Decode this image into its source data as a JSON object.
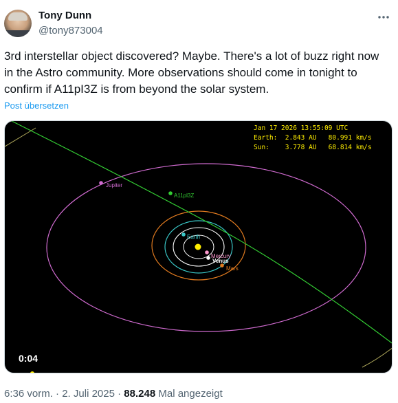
{
  "author": {
    "name": "Tony Dunn",
    "handle": "@tony873004"
  },
  "tweet": {
    "text": "3rd interstellar object discovered? Maybe. There's a lot of buzz right now in the Astro community. More observations should come in tonight to confirm if A11pI3Z is from beyond the solar system.",
    "translate_label": "Post übersetzen"
  },
  "media": {
    "info_line1": "Jan 17 2026 13:55:09 UTC",
    "info_line2": "Earth:  2.843 AU   80.991 km/s",
    "info_line3": "Sun:    3.778 AU   68.814 km/s",
    "video_time": "0:04",
    "labels": {
      "jupiter": "Jupiter",
      "object": "A11pl3Z",
      "earth": "Earth",
      "mercury": "Mercury",
      "venus": "Venus",
      "mars": "Mars"
    },
    "colors": {
      "jupiter": "#d06bd0",
      "object": "#33cc33",
      "earth": "#39c6c6",
      "mars": "#e07a1f",
      "venus": "#ffffff",
      "mercury": "#ff9ad0",
      "sun": "#ffee00",
      "info_text": "#ffee00"
    }
  },
  "meta": {
    "time": "6:36 vorm.",
    "separator": "·",
    "date": "2. Juli 2025",
    "views_count": "88.248",
    "views_label": "Mal angezeigt"
  }
}
